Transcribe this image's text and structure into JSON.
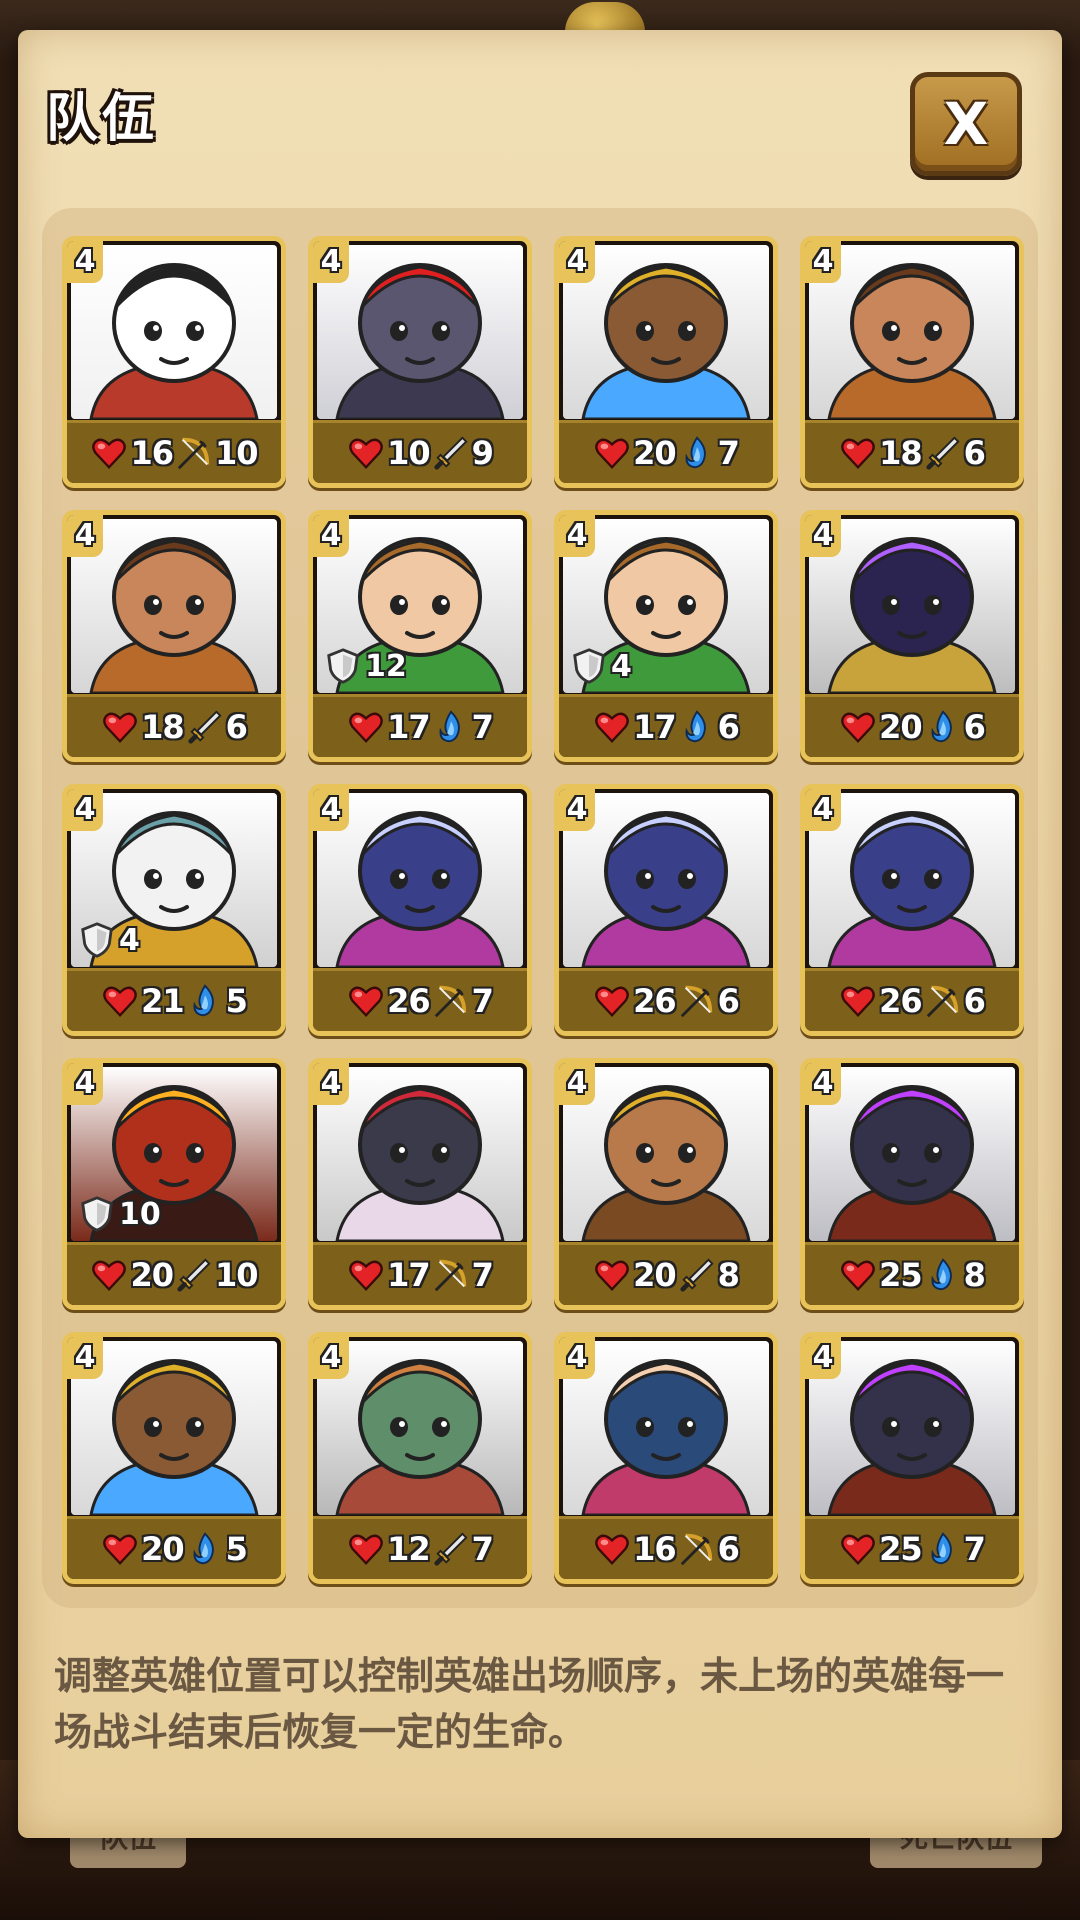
{
  "title": "队伍",
  "close_label": "X",
  "background_buttons": [
    "队伍",
    "死亡队伍"
  ],
  "description": "调整英雄位置可以控制英雄出场顺序，未上场的英雄每一场战斗结束后恢复一定的生命。",
  "colors": {
    "card_border": "#e7c35a",
    "stat_bar": "#7d6019",
    "panel": "#ecd6a8",
    "description_text": "#6a5843"
  },
  "heroes": [
    {
      "level": "4",
      "portrait": "panda-hero",
      "hp": "16",
      "atk_type": "bow",
      "atk": "10",
      "shield": ""
    },
    {
      "level": "4",
      "portrait": "armored-knight",
      "hp": "10",
      "atk_type": "sword",
      "atk": "9",
      "shield": ""
    },
    {
      "level": "4",
      "portrait": "pharaoh-mage",
      "hp": "20",
      "atk_type": "magic",
      "atk": "7",
      "shield": ""
    },
    {
      "level": "4",
      "portrait": "brown-haired-warrior",
      "hp": "18",
      "atk_type": "sword",
      "atk": "6",
      "shield": ""
    },
    {
      "level": "4",
      "portrait": "brown-haired-warrior",
      "hp": "18",
      "atk_type": "sword",
      "atk": "6",
      "shield": ""
    },
    {
      "level": "4",
      "portrait": "elf-druid",
      "hp": "17",
      "atk_type": "magic",
      "atk": "7",
      "shield": "12"
    },
    {
      "level": "4",
      "portrait": "elf-druid",
      "hp": "17",
      "atk_type": "magic",
      "atk": "6",
      "shield": "4"
    },
    {
      "level": "4",
      "portrait": "dark-sorcerer",
      "hp": "20",
      "atk_type": "magic",
      "atk": "6",
      "shield": ""
    },
    {
      "level": "4",
      "portrait": "white-hooded-priestess",
      "hp": "21",
      "atk_type": "magic",
      "atk": "5",
      "shield": "4"
    },
    {
      "level": "4",
      "portrait": "dark-elf-archer",
      "hp": "26",
      "atk_type": "bow",
      "atk": "7",
      "shield": ""
    },
    {
      "level": "4",
      "portrait": "dark-elf-archer",
      "hp": "26",
      "atk_type": "bow",
      "atk": "6",
      "shield": ""
    },
    {
      "level": "4",
      "portrait": "dark-elf-archer",
      "hp": "26",
      "atk_type": "bow",
      "atk": "6",
      "shield": ""
    },
    {
      "level": "4",
      "portrait": "fire-demon",
      "hp": "20",
      "atk_type": "sword",
      "atk": "10",
      "shield": "10"
    },
    {
      "level": "4",
      "portrait": "spider-queen",
      "hp": "17",
      "atk_type": "bow",
      "atk": "7",
      "shield": ""
    },
    {
      "level": "4",
      "portrait": "bearded-paladin",
      "hp": "20",
      "atk_type": "sword",
      "atk": "8",
      "shield": ""
    },
    {
      "level": "4",
      "portrait": "hooded-assassin",
      "hp": "25",
      "atk_type": "magic",
      "atk": "8",
      "shield": ""
    },
    {
      "level": "4",
      "portrait": "pharaoh-mage",
      "hp": "20",
      "atk_type": "magic",
      "atk": "5",
      "shield": ""
    },
    {
      "level": "4",
      "portrait": "zombie-brute",
      "hp": "12",
      "atk_type": "sword",
      "atk": "7",
      "shield": ""
    },
    {
      "level": "4",
      "portrait": "blue-haired-heroine",
      "hp": "16",
      "atk_type": "bow",
      "atk": "6",
      "shield": ""
    },
    {
      "level": "4",
      "portrait": "hooded-assassin",
      "hp": "25",
      "atk_type": "magic",
      "atk": "7",
      "shield": ""
    }
  ]
}
